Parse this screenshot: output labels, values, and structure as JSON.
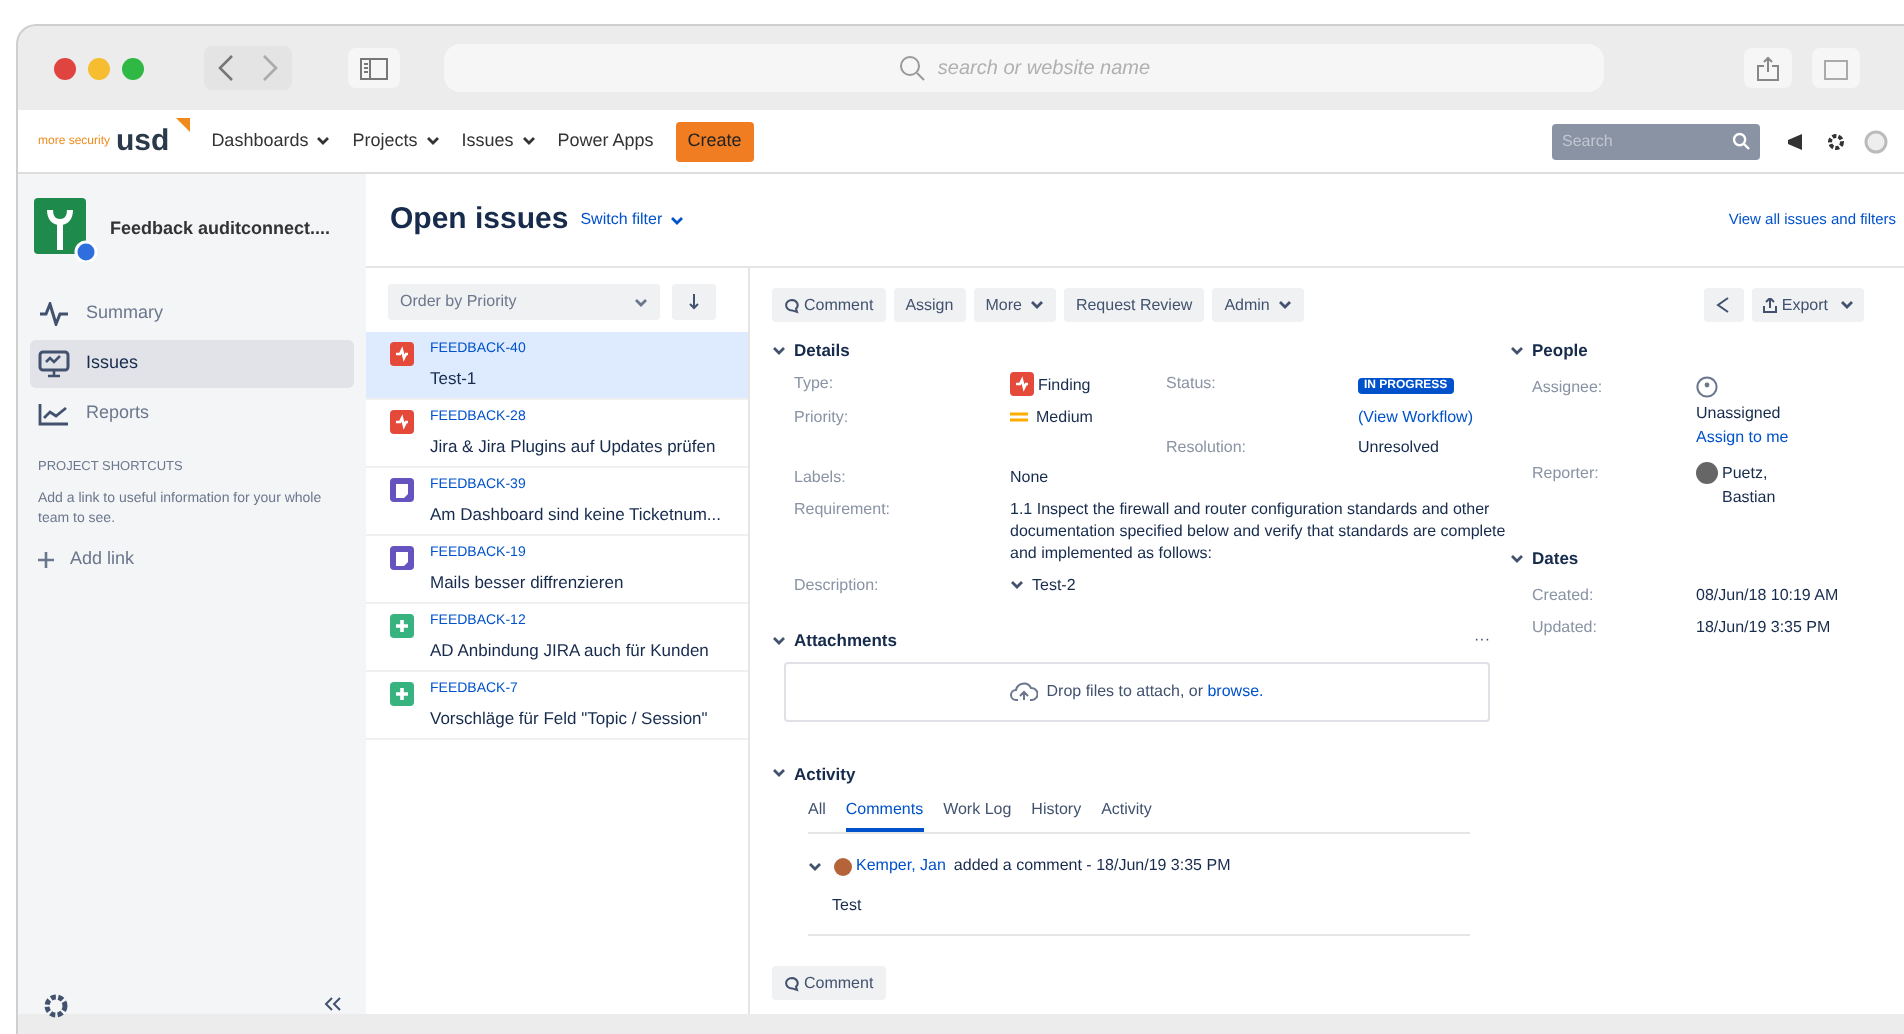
{
  "browser": {
    "address_placeholder": "search or website name"
  },
  "nav": {
    "logo_tagline": "more security",
    "logo": "usd",
    "menus": [
      {
        "label": "Dashboards",
        "dropdown": true
      },
      {
        "label": "Projects",
        "dropdown": true
      },
      {
        "label": "Issues",
        "dropdown": true
      },
      {
        "label": "Power Apps",
        "dropdown": false
      }
    ],
    "create": "Create",
    "search_placeholder": "Search"
  },
  "sidebar": {
    "project": "Feedback auditconnect....",
    "items": [
      {
        "label": "Summary",
        "kind": "pulse",
        "selected": false
      },
      {
        "label": "Issues",
        "kind": "monitor",
        "selected": true
      },
      {
        "label": "Reports",
        "kind": "chart",
        "selected": false
      }
    ],
    "shortcuts_heading": "PROJECT SHORTCUTS",
    "shortcuts_text": "Add a link to useful information for your whole team to see.",
    "add_link": "Add link"
  },
  "header": {
    "title": "Open issues",
    "switch_filter": "Switch filter",
    "view_all": "View all issues and filters"
  },
  "issue_list": {
    "order": "Order by Priority",
    "issues": [
      {
        "key": "FEEDBACK-40",
        "summary": "Test-1",
        "kind": "finding",
        "selected": true
      },
      {
        "key": "FEEDBACK-28",
        "summary": "Jira & Jira Plugins auf Updates prüfen",
        "kind": "finding",
        "selected": false
      },
      {
        "key": "FEEDBACK-39",
        "summary": "Am Dashboard sind keine Ticketnum...",
        "kind": "task",
        "selected": false
      },
      {
        "key": "FEEDBACK-19",
        "summary": "Mails besser diffrenzieren",
        "kind": "task",
        "selected": false
      },
      {
        "key": "FEEDBACK-12",
        "summary": "AD Anbindung JIRA auch für Kunden",
        "kind": "story",
        "selected": false
      },
      {
        "key": "FEEDBACK-7",
        "summary": "Vorschläge für Feld \"Topic / Session\"",
        "kind": "story",
        "selected": false
      }
    ]
  },
  "toolbar": [
    {
      "label": "Comment",
      "kind": "comment"
    },
    {
      "label": "Assign",
      "kind": "plain"
    },
    {
      "label": "More",
      "kind": "dropdown"
    },
    {
      "label": "Request Review",
      "kind": "plain"
    },
    {
      "label": "Admin",
      "kind": "dropdown"
    }
  ],
  "export": "Export",
  "details": {
    "heading": "Details",
    "type_label": "Type:",
    "type": "Finding",
    "priority_label": "Priority:",
    "priority": "Medium",
    "status_label": "Status:",
    "status": "IN PROGRESS",
    "view_workflow": "(View Workflow)",
    "resolution_label": "Resolution:",
    "resolution": "Unresolved",
    "labels_label": "Labels:",
    "labels": "None",
    "requirement_label": "Requirement:",
    "requirement": "1.1 Inspect the firewall and router configuration standards and other documentation specified below and verify that standards are complete and implemented as follows:",
    "description_label": "Description:",
    "description": "Test-2"
  },
  "attachments": {
    "heading": "Attachments",
    "more": "···",
    "drop_text": "Drop files to attach, or ",
    "browse": "browse."
  },
  "activity": {
    "heading": "Activity",
    "tabs": [
      {
        "label": "All",
        "selected": false
      },
      {
        "label": "Comments",
        "selected": true
      },
      {
        "label": "Work Log",
        "selected": false
      },
      {
        "label": "History",
        "selected": false
      },
      {
        "label": "Activity",
        "selected": false
      }
    ],
    "comment": {
      "author": "Kemper, Jan",
      "meta": "added a comment - 18/Jun/19 3:35 PM",
      "body": "Test"
    },
    "comment_button": "Comment"
  },
  "people": {
    "heading": "People",
    "assignee_label": "Assignee:",
    "assignee": "Unassigned",
    "assign_to_me": "Assign to me",
    "reporter_label": "Reporter:",
    "reporter": "Puetz, Bastian"
  },
  "dates": {
    "heading": "Dates",
    "created_label": "Created:",
    "created": "08/Jun/18 10:19 AM",
    "updated_label": "Updated:",
    "updated": "18/Jun/19 3:35 PM"
  }
}
